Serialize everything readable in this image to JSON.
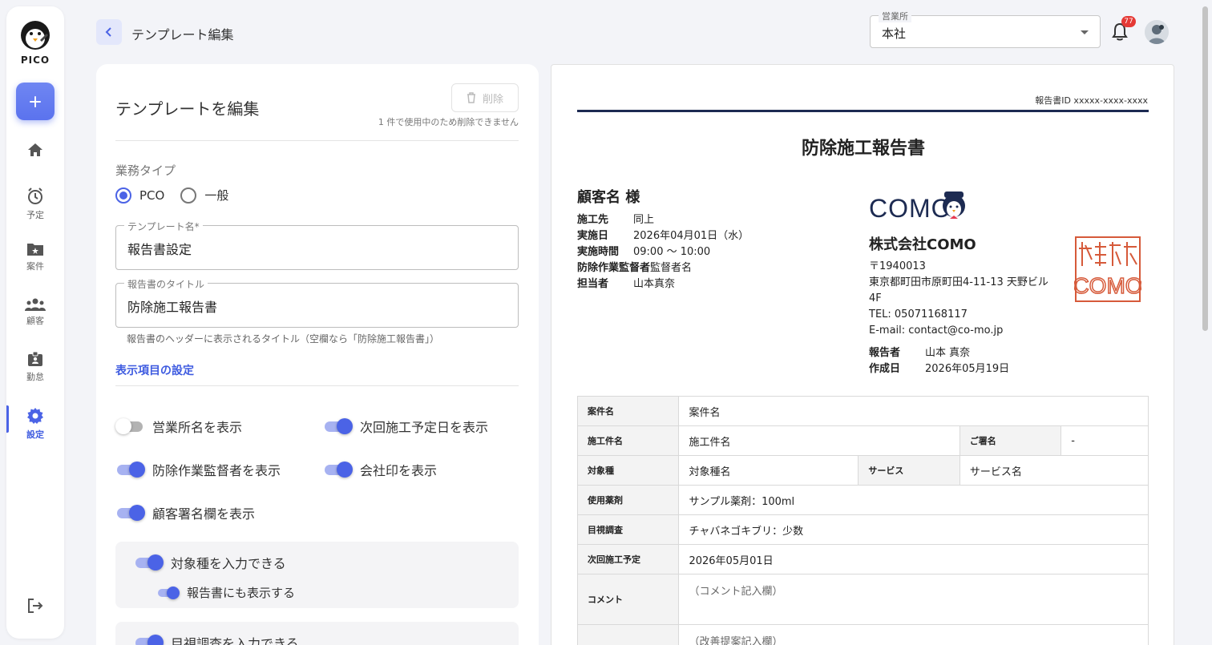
{
  "app": {
    "brand": "PICO",
    "brand_color": "#4b63e6"
  },
  "sidebar": {
    "items": [
      {
        "label": "",
        "icon": "home-icon"
      },
      {
        "label": "予定",
        "icon": "alarm-clock-icon"
      },
      {
        "label": "案件",
        "icon": "folder-star-icon"
      },
      {
        "label": "顧客",
        "icon": "people-icon"
      },
      {
        "label": "勤怠",
        "icon": "id-badge-icon"
      },
      {
        "label": "設定",
        "icon": "gear-icon",
        "active": true
      }
    ]
  },
  "header": {
    "title": "テンプレート編集",
    "office_label": "営業所",
    "office_value": "本社",
    "notification_count": "77"
  },
  "editor": {
    "heading": "テンプレートを編集",
    "delete_label": "削除",
    "delete_note": "1 件で使用中のため削除できません",
    "job_type_label": "業務タイプ",
    "job_type_options": [
      "PCO",
      "一般"
    ],
    "template_name_label": "テンプレート名*",
    "template_name_value": "報告書設定",
    "report_title_label": "報告書のタイトル",
    "report_title_value": "防除施工報告書",
    "report_title_helper": "報告書のヘッダーに表示されるタイトル（空欄なら「防除施工報告書」）",
    "display_settings_link": "表示項目の設定",
    "toggles": [
      {
        "label": "営業所名を表示",
        "on": false
      },
      {
        "label": "次回施工予定日を表示",
        "on": true
      },
      {
        "label": "防除作業監督者を表示",
        "on": true
      },
      {
        "label": "会社印を表示",
        "on": true
      },
      {
        "label": "顧客署名欄を表示",
        "on": true
      }
    ],
    "sub_toggles": [
      {
        "label": "対象種を入力できる",
        "on": true
      },
      {
        "label": "報告書にも表示する",
        "on": true
      },
      {
        "label": "目視調査を入力できる",
        "on": true
      }
    ]
  },
  "report": {
    "report_id": "報告書ID xxxxx-xxxx-xxxx",
    "title": "防除施工報告書",
    "customer": "顧客名 様",
    "info": [
      {
        "k": "施工先",
        "v": "同上"
      },
      {
        "k": "実施日",
        "v": "2026年04月01日（水）"
      },
      {
        "k": "実施時間",
        "v": "09:00 〜 10:00"
      },
      {
        "k": "防除作業監督者",
        "v": "監督者名"
      },
      {
        "k": "担当者",
        "v": "山本真奈"
      }
    ],
    "logo_text": "COMO",
    "company": "株式会社COMO",
    "postal": "〒1940013",
    "address": "東京都町田市原町田4-11-13 天野ビル4F",
    "tel": "TEL: 05071168117",
    "email": "E-mail: contact@co-mo.jp",
    "reporter_label": "報告者",
    "reporter_value": "山本 真奈",
    "created_label": "作成日",
    "created_value": "2026年05月19日",
    "table": {
      "case_name_k": "案件名",
      "case_name_v": "案件名",
      "work_name_k": "施工件名",
      "work_name_v": "施工件名",
      "signature_k": "ご署名",
      "signature_v": "-",
      "target_k": "対象種",
      "target_v": "対象種名",
      "service_k": "サービス",
      "service_v": "サービス名",
      "chem_k": "使用薬剤",
      "chem_v": "サンプル薬剤：100ml",
      "visual_k": "目視調査",
      "visual_v": "チャバネゴキブリ：少数",
      "next_k": "次回施工予定",
      "next_v": "2026年05月01日",
      "comment_k": "コメント",
      "comment_v": "（コメント記入欄）",
      "improve_v": "（改善提案記入欄）"
    }
  }
}
